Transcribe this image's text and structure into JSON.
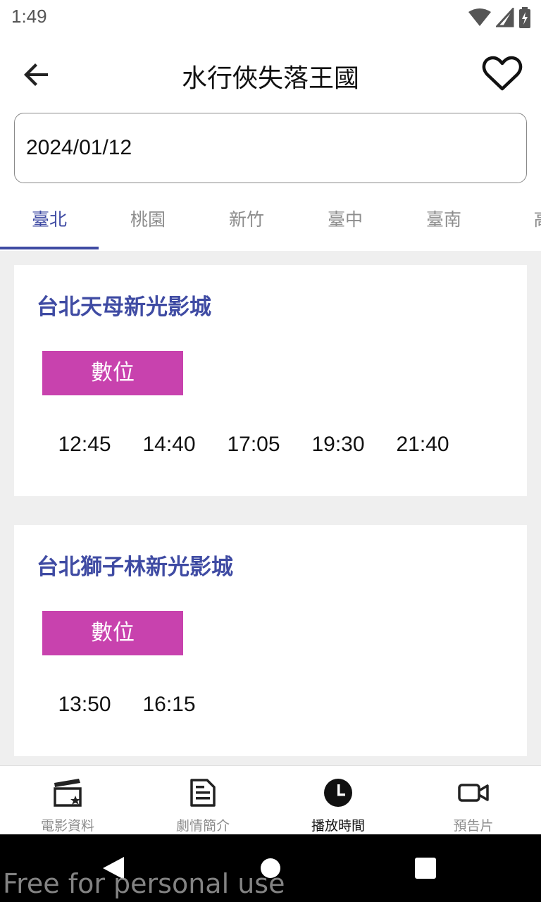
{
  "status_bar": {
    "time": "1:49"
  },
  "header": {
    "title": "水行俠失落王國"
  },
  "date_field": {
    "value": "2024/01/12"
  },
  "tabs": [
    {
      "label": "臺北",
      "active": true
    },
    {
      "label": "桃園",
      "active": false
    },
    {
      "label": "新竹",
      "active": false
    },
    {
      "label": "臺中",
      "active": false
    },
    {
      "label": "臺南",
      "active": false
    },
    {
      "label": "高",
      "active": false
    }
  ],
  "cinemas": [
    {
      "name": "台北天母新光影城",
      "format": "數位",
      "times": [
        "12:45",
        "14:40",
        "17:05",
        "19:30",
        "21:40"
      ]
    },
    {
      "name": "台北獅子林新光影城",
      "format": "數位",
      "times": [
        "13:50",
        "16:15"
      ]
    }
  ],
  "bottom_nav": [
    {
      "label": "電影資料",
      "icon": "clapperboard-icon",
      "active": false
    },
    {
      "label": "劇情簡介",
      "icon": "document-icon",
      "active": false
    },
    {
      "label": "播放時間",
      "icon": "clock-icon",
      "active": true
    },
    {
      "label": "預告片",
      "icon": "video-camera-icon",
      "active": false
    }
  ],
  "watermark": "Free for personal use",
  "colors": {
    "accent": "#3f4ba3",
    "badge": "#c842ae",
    "background": "#efefef"
  }
}
